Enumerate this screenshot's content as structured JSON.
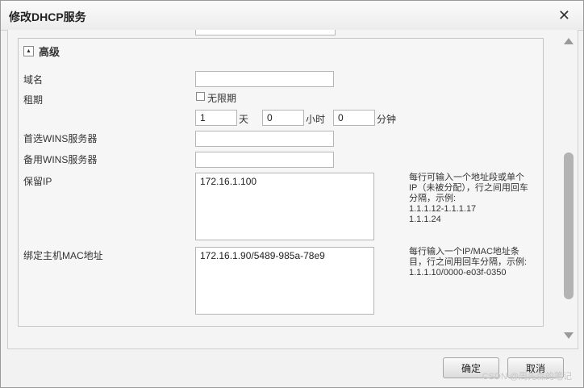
{
  "dialog": {
    "title": "修改DHCP服务"
  },
  "advanced": {
    "section_title": "高级",
    "domain_label": "域名",
    "domain_value": "",
    "lease_label": "租期",
    "unlimited_label": "无限期",
    "days_value": "1",
    "days_unit": "天",
    "hours_value": "0",
    "hours_unit": "小时",
    "minutes_value": "0",
    "minutes_unit": "分钟",
    "wins_primary_label": "首选WINS服务器",
    "wins_primary_value": "",
    "wins_backup_label": "备用WINS服务器",
    "wins_backup_value": "",
    "reserved_ip_label": "保留IP",
    "reserved_ip_value": "172.16.1.100",
    "reserved_ip_hint": "每行可输入一个地址段或单个IP（未被分配），行之间用回车分隔，示例:",
    "reserved_ip_example1": "1.1.1.12-1.1.1.17",
    "reserved_ip_example2": "1.1.1.24",
    "mac_binding_label": "绑定主机MAC地址",
    "mac_binding_value": "172.16.1.90/5489-985a-78e9",
    "mac_binding_hint": "每行输入一个IP/MAC地址条目，行之间用回车分隔，示例:",
    "mac_binding_example": "1.1.1.10/0000-e03f-0350"
  },
  "footer": {
    "ok_label": "确定",
    "cancel_label": "取消"
  },
  "watermark": "CSDN @周先森的笔记"
}
